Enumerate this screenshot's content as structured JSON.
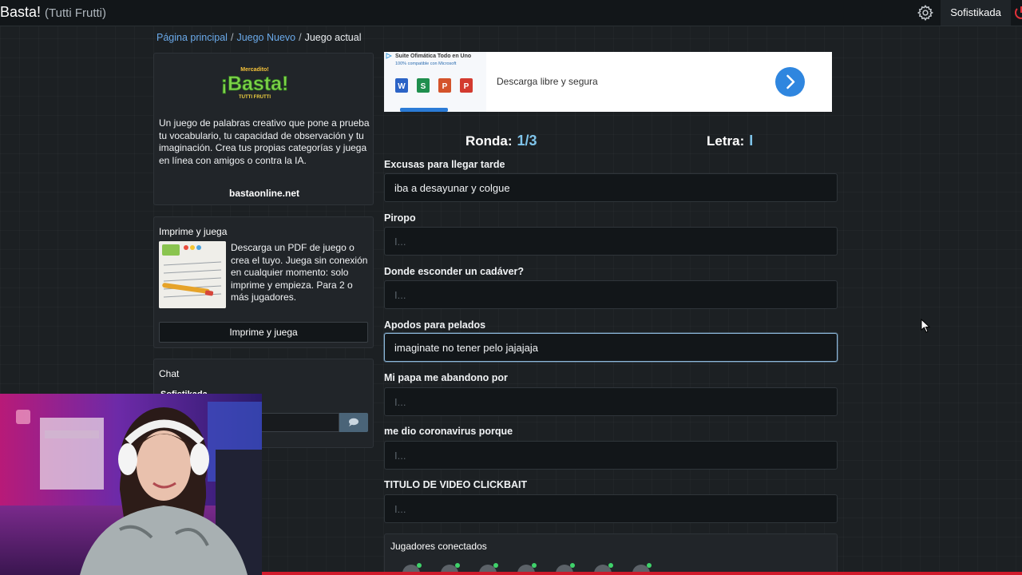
{
  "navbar": {
    "brand": "Basta!",
    "brand_sub": "(Tutti Frutti)",
    "user": "Sofistikada",
    "icons": [
      "gear-icon",
      "power-icon"
    ]
  },
  "breadcrumb": {
    "home": "Página principal",
    "new_game": "Juego Nuevo",
    "current": "Juego actual"
  },
  "about": {
    "logo_top": "Mercadito!",
    "logo_main": "¡Basta!",
    "logo_bottom": "TUTTI FRUTTI",
    "text": "Un juego de palabras creativo que pone a prueba tu vocabulario, tu capacidad de observación y tu imaginación. Crea tus propias categorías y juega en línea con amigos o contra la IA.",
    "site": "bastaonline.net"
  },
  "print": {
    "title": "Imprime y juega",
    "text": "Descarga un PDF de juego o crea el tuyo. Juega sin conexión en cualquier momento: solo imprime y empieza. Para 2 o más jugadores.",
    "button": "Imprime y juega"
  },
  "chat": {
    "title": "Chat",
    "user": "Sofistikada"
  },
  "ad": {
    "title": "Suite Ofimática Todo en Uno",
    "subtitle": "100% compatible con Microsoft",
    "text": "Descarga libre y segura"
  },
  "game": {
    "round_label": "Ronda:",
    "round_value": "1/3",
    "letter_label": "Letra:",
    "letter_value": "I"
  },
  "fields": [
    {
      "label": "Excusas para llegar tarde",
      "value": "iba a desayunar y colgue",
      "placeholder": "I..."
    },
    {
      "label": "Piropo",
      "value": "",
      "placeholder": "I..."
    },
    {
      "label": "Donde esconder un cadáver?",
      "value": "",
      "placeholder": "I..."
    },
    {
      "label": "Apodos para pelados",
      "value": "imaginate no tener pelo jajajaja",
      "placeholder": "I..."
    },
    {
      "label": "Mi papa me abandono por",
      "value": "",
      "placeholder": "I..."
    },
    {
      "label": "me dio coronavirus porque",
      "value": "",
      "placeholder": "I..."
    },
    {
      "label": "TITULO DE VIDEO CLICKBAIT",
      "value": "",
      "placeholder": "I..."
    }
  ],
  "players": {
    "title": "Jugadores conectados",
    "count": 7
  }
}
